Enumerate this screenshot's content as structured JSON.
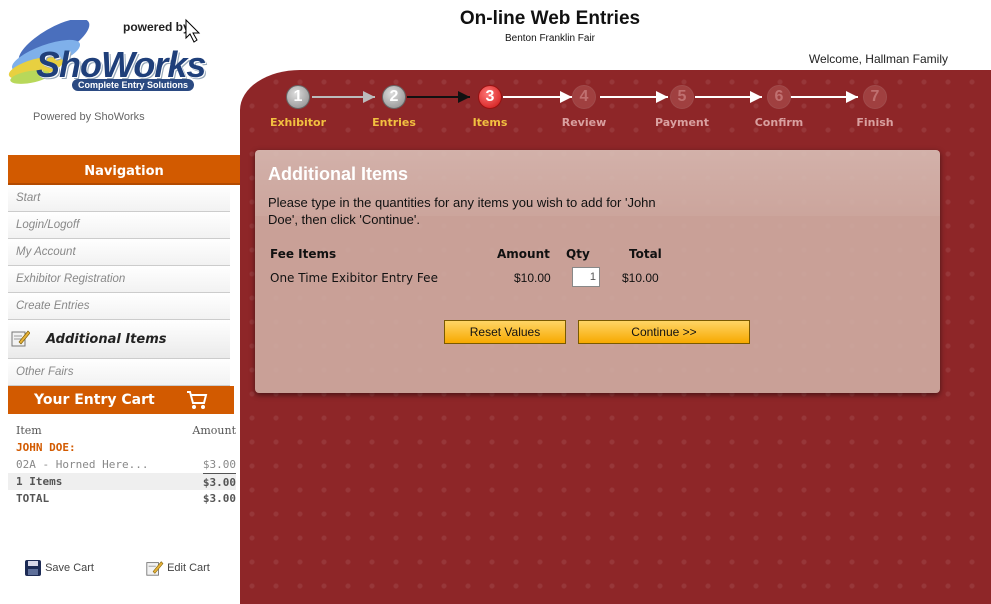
{
  "header": {
    "powered_by_top": "powered by",
    "logo_word": "ShoWorks",
    "logo_tagline": "Complete Entry Solutions",
    "powered_caption": "Powered by ShoWorks",
    "title": "On-line Web Entries",
    "subtitle": "Benton Franklin Fair",
    "welcome": "Welcome, Hallman Family"
  },
  "steps": [
    {
      "num": "1",
      "label": "Exhibitor",
      "state": "done"
    },
    {
      "num": "2",
      "label": "Entries",
      "state": "done"
    },
    {
      "num": "3",
      "label": "Items",
      "state": "active"
    },
    {
      "num": "4",
      "label": "Review",
      "state": "todo"
    },
    {
      "num": "5",
      "label": "Payment",
      "state": "todo"
    },
    {
      "num": "6",
      "label": "Confirm",
      "state": "todo"
    },
    {
      "num": "7",
      "label": "Finish",
      "state": "todo"
    }
  ],
  "sidebar": {
    "nav_title": "Navigation",
    "items": [
      {
        "label": "Start"
      },
      {
        "label": "Login/Logoff"
      },
      {
        "label": "My Account"
      },
      {
        "label": "Exhibitor Registration"
      },
      {
        "label": "Create Entries"
      },
      {
        "label": "Additional Items"
      },
      {
        "label": "Other Fairs"
      }
    ],
    "cart_title": "Your Entry Cart"
  },
  "cart": {
    "col_item": "Item",
    "col_amount": "Amount",
    "exhibitor": "JOHN DOE:",
    "line_item": "02A - Horned Here...",
    "line_amount": "$3.00",
    "count_label": "1 Items",
    "count_amount": "$3.00",
    "total_label": "TOTAL",
    "total_amount": "$3.00",
    "save_label": "Save Cart",
    "edit_label": "Edit Cart"
  },
  "panel": {
    "title": "Additional Items",
    "description": "Please type in the quantities for any items you wish to add for 'John Doe', then click 'Continue'.",
    "col_fee": "Fee Items",
    "col_amount": "Amount",
    "col_qty": "Qty",
    "col_total": "Total",
    "row_fee": "One Time Exibitor Entry Fee",
    "row_amount": "$10.00",
    "row_qty": "1",
    "row_total": "$10.00",
    "reset_label": "Reset Values",
    "continue_label": "Continue >>"
  },
  "colors": {
    "maroon": "#8e2628",
    "orange": "#d25a00",
    "gold_button": "#f7a900",
    "step_done_label": "#f2c040"
  }
}
